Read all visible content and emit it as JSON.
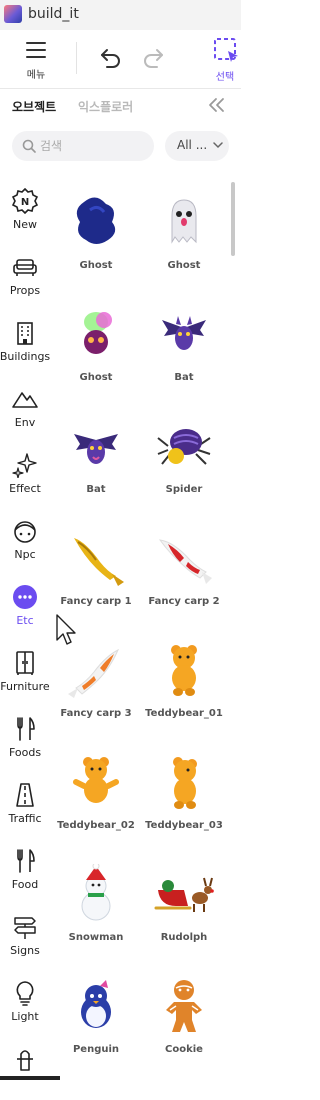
{
  "app": {
    "title": "build_it"
  },
  "toolbar": {
    "menu_label": "메뉴",
    "select_label": "선택"
  },
  "tabs": {
    "objects": "오브젝트",
    "explorer": "익스플로러"
  },
  "search": {
    "placeholder": "검색"
  },
  "filter": {
    "value": "All ..."
  },
  "categories": [
    {
      "label": "New",
      "icon": "new-badge-icon"
    },
    {
      "label": "Props",
      "icon": "sofa-icon"
    },
    {
      "label": "Buildings",
      "icon": "building-icon"
    },
    {
      "label": "Env",
      "icon": "mountain-icon"
    },
    {
      "label": "Effect",
      "icon": "sparkle-icon"
    },
    {
      "label": "Npc",
      "icon": "npc-face-icon"
    },
    {
      "label": "Etc",
      "icon": "more-dots-icon"
    },
    {
      "label": "Furniture",
      "icon": "wardrobe-icon"
    },
    {
      "label": "Foods",
      "icon": "fork-knife-icon"
    },
    {
      "label": "Traffic",
      "icon": "road-icon"
    },
    {
      "label": "Food",
      "icon": "fork-knife-icon"
    },
    {
      "label": "Signs",
      "icon": "signpost-icon"
    },
    {
      "label": "Light",
      "icon": "bulb-icon"
    }
  ],
  "items": [
    {
      "label": "Ghost"
    },
    {
      "label": "Ghost"
    },
    {
      "label": "Ghost"
    },
    {
      "label": "Bat"
    },
    {
      "label": "Bat"
    },
    {
      "label": "Spider"
    },
    {
      "label": "Fancy carp 1"
    },
    {
      "label": "Fancy carp 2"
    },
    {
      "label": "Fancy carp 3"
    },
    {
      "label": "Teddybear_01"
    },
    {
      "label": "Teddybear_02"
    },
    {
      "label": "Teddybear_03"
    },
    {
      "label": "Snowman"
    },
    {
      "label": "Rudolph"
    },
    {
      "label": "Penguin"
    },
    {
      "label": "Cookie"
    }
  ],
  "colors": {
    "accent": "#6b4cf0",
    "text": "#222222",
    "muted": "#b9b9b9"
  }
}
